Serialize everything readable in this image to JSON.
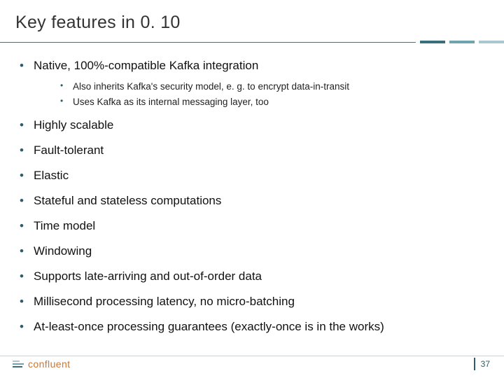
{
  "title": "Key features in 0. 10",
  "bullets": {
    "b0": "Native, 100%-compatible Kafka integration",
    "b0_sub": {
      "s0": "Also inherits Kafka's security model, e. g. to encrypt data-in-transit",
      "s1": "Uses Kafka as its internal messaging layer, too"
    },
    "b1": "Highly scalable",
    "b2": "Fault-tolerant",
    "b3": "Elastic",
    "b4": "Stateful and stateless computations",
    "b5": "Time model",
    "b6": "Windowing",
    "b7": "Supports late-arriving and out-of-order data",
    "b8": "Millisecond processing latency, no micro-batching",
    "b9": "At-least-once processing guarantees (exactly-once is in the works)"
  },
  "footer": {
    "brand": "confluent",
    "page": "37"
  },
  "colors": {
    "accent_dark": "#2b5d6a",
    "accent_mid": "#6fa3ad",
    "accent_light": "#a9c7cd",
    "brand_orange": "#d1752b"
  }
}
